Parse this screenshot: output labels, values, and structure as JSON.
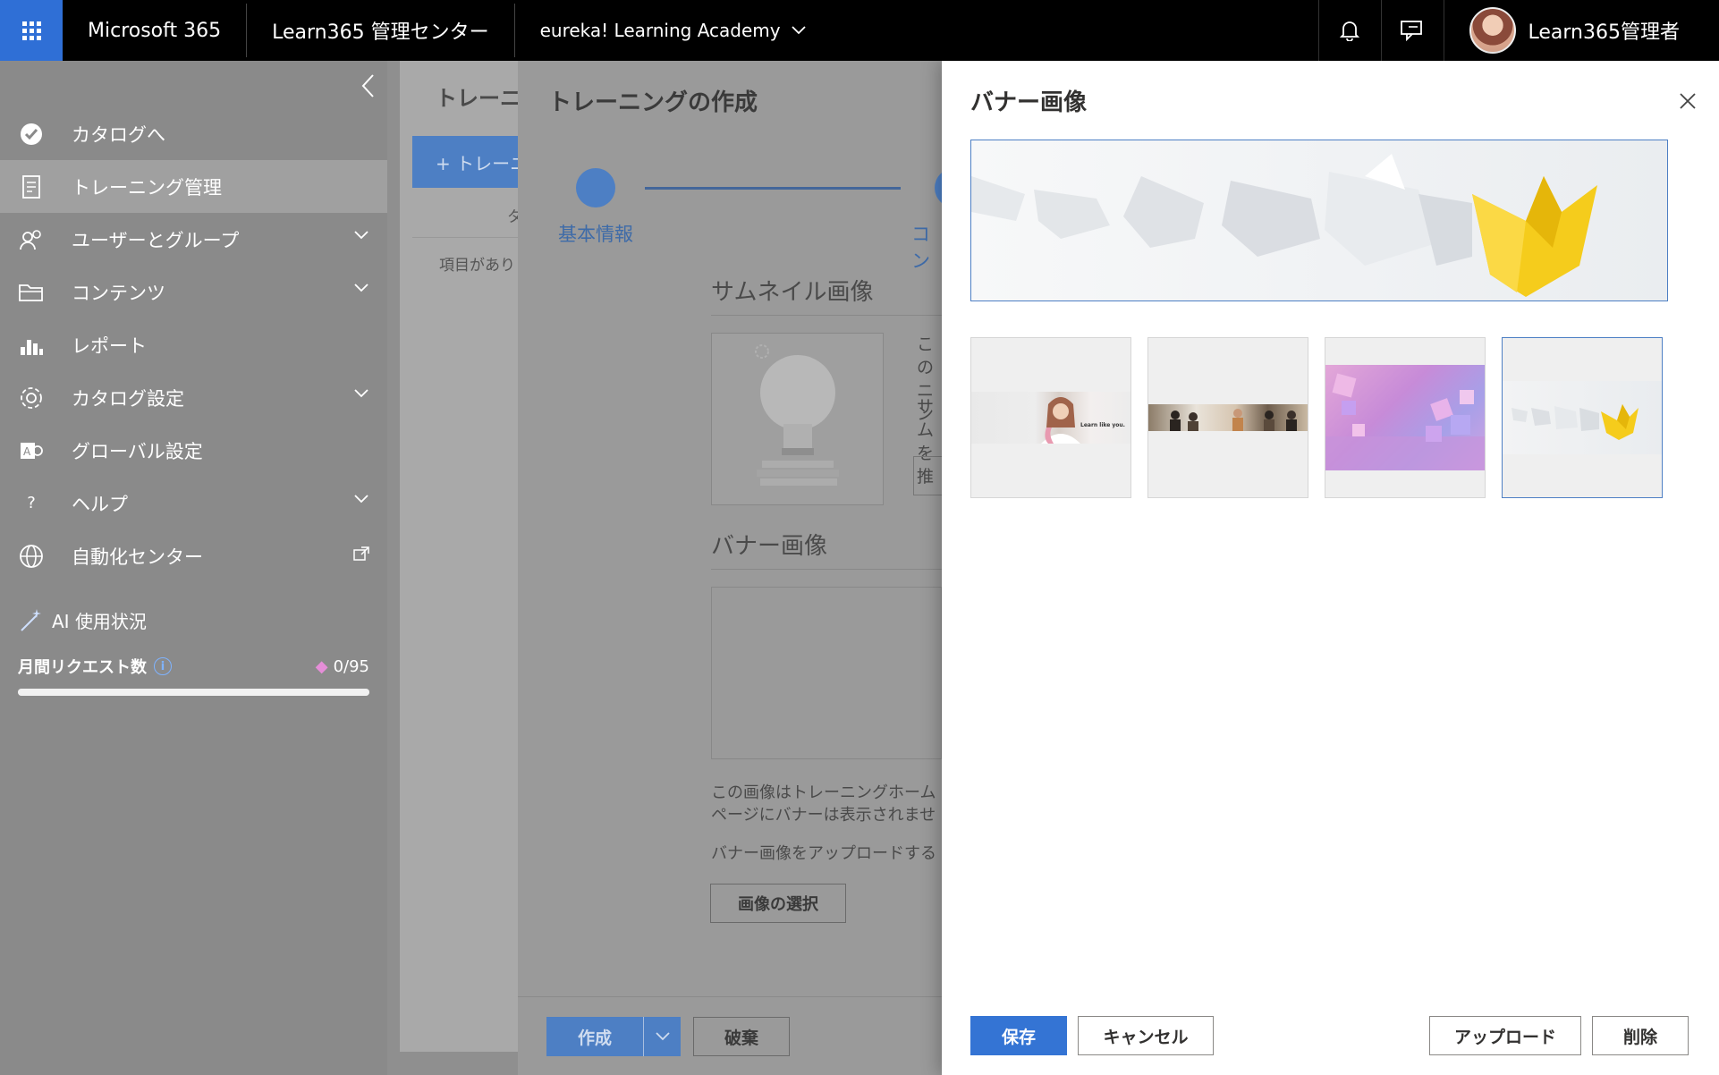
{
  "topbar": {
    "app_name": "Microsoft 365",
    "admin_center": "Learn365 管理センター",
    "tenant": "eureka! Learning Academy",
    "user": "Learn365管理者",
    "icons": [
      "waffle-icon",
      "bell-icon",
      "feedback-icon",
      "chevron-down-icon"
    ]
  },
  "sidebar": {
    "items": [
      {
        "label": "カタログへ",
        "icon": "check-circle-icon"
      },
      {
        "label": "トレーニング管理",
        "icon": "document-icon",
        "active": true
      },
      {
        "label": "ユーザーとグループ",
        "icon": "people-icon",
        "expandable": true
      },
      {
        "label": "コンテンツ",
        "icon": "folder-icon",
        "expandable": true
      },
      {
        "label": "レポート",
        "icon": "bar-chart-icon"
      },
      {
        "label": "カタログ設定",
        "icon": "gear-icon",
        "expandable": true
      },
      {
        "label": "グローバル設定",
        "icon": "settings-a-icon"
      },
      {
        "label": "ヘルプ",
        "icon": "question-icon",
        "expandable": true
      },
      {
        "label": "自動化センター",
        "icon": "globe-icon",
        "external": true
      }
    ],
    "ai": {
      "title": "AI 使用状況",
      "request_label": "月間リクエスト数",
      "usage": "0/95",
      "progress": 1.0
    }
  },
  "background": {
    "title": "トレーニン",
    "add_button": "+ トレーニ",
    "col_header": "タ",
    "empty": "項目があり"
  },
  "create_panel": {
    "title": "トレーニングの作成",
    "steps": [
      "基本情報",
      "コン"
    ],
    "thumbnail": {
      "title": "サムネイル画像",
      "text1": "この",
      "text2": "ニン",
      "text3": "サム",
      "text4": "を推"
    },
    "banner": {
      "title": "バナー画像",
      "desc1": "この画像はトレーニングホーム",
      "desc2": "ページにバナーは表示されませ",
      "desc3": "バナー画像をアップロードする",
      "select_button": "画像の選択"
    },
    "create_button": "作成",
    "discard_button": "破棄"
  },
  "dialog": {
    "title": "バナー画像",
    "selected_index": 3,
    "options": [
      {
        "name": "woman-smiling",
        "caption": "Learn like you."
      },
      {
        "name": "team-meeting"
      },
      {
        "name": "pink-cubes"
      },
      {
        "name": "paper-boats"
      }
    ],
    "save_button": "保存",
    "cancel_button": "キャンセル",
    "upload_button": "アップロード",
    "delete_button": "削除"
  }
}
